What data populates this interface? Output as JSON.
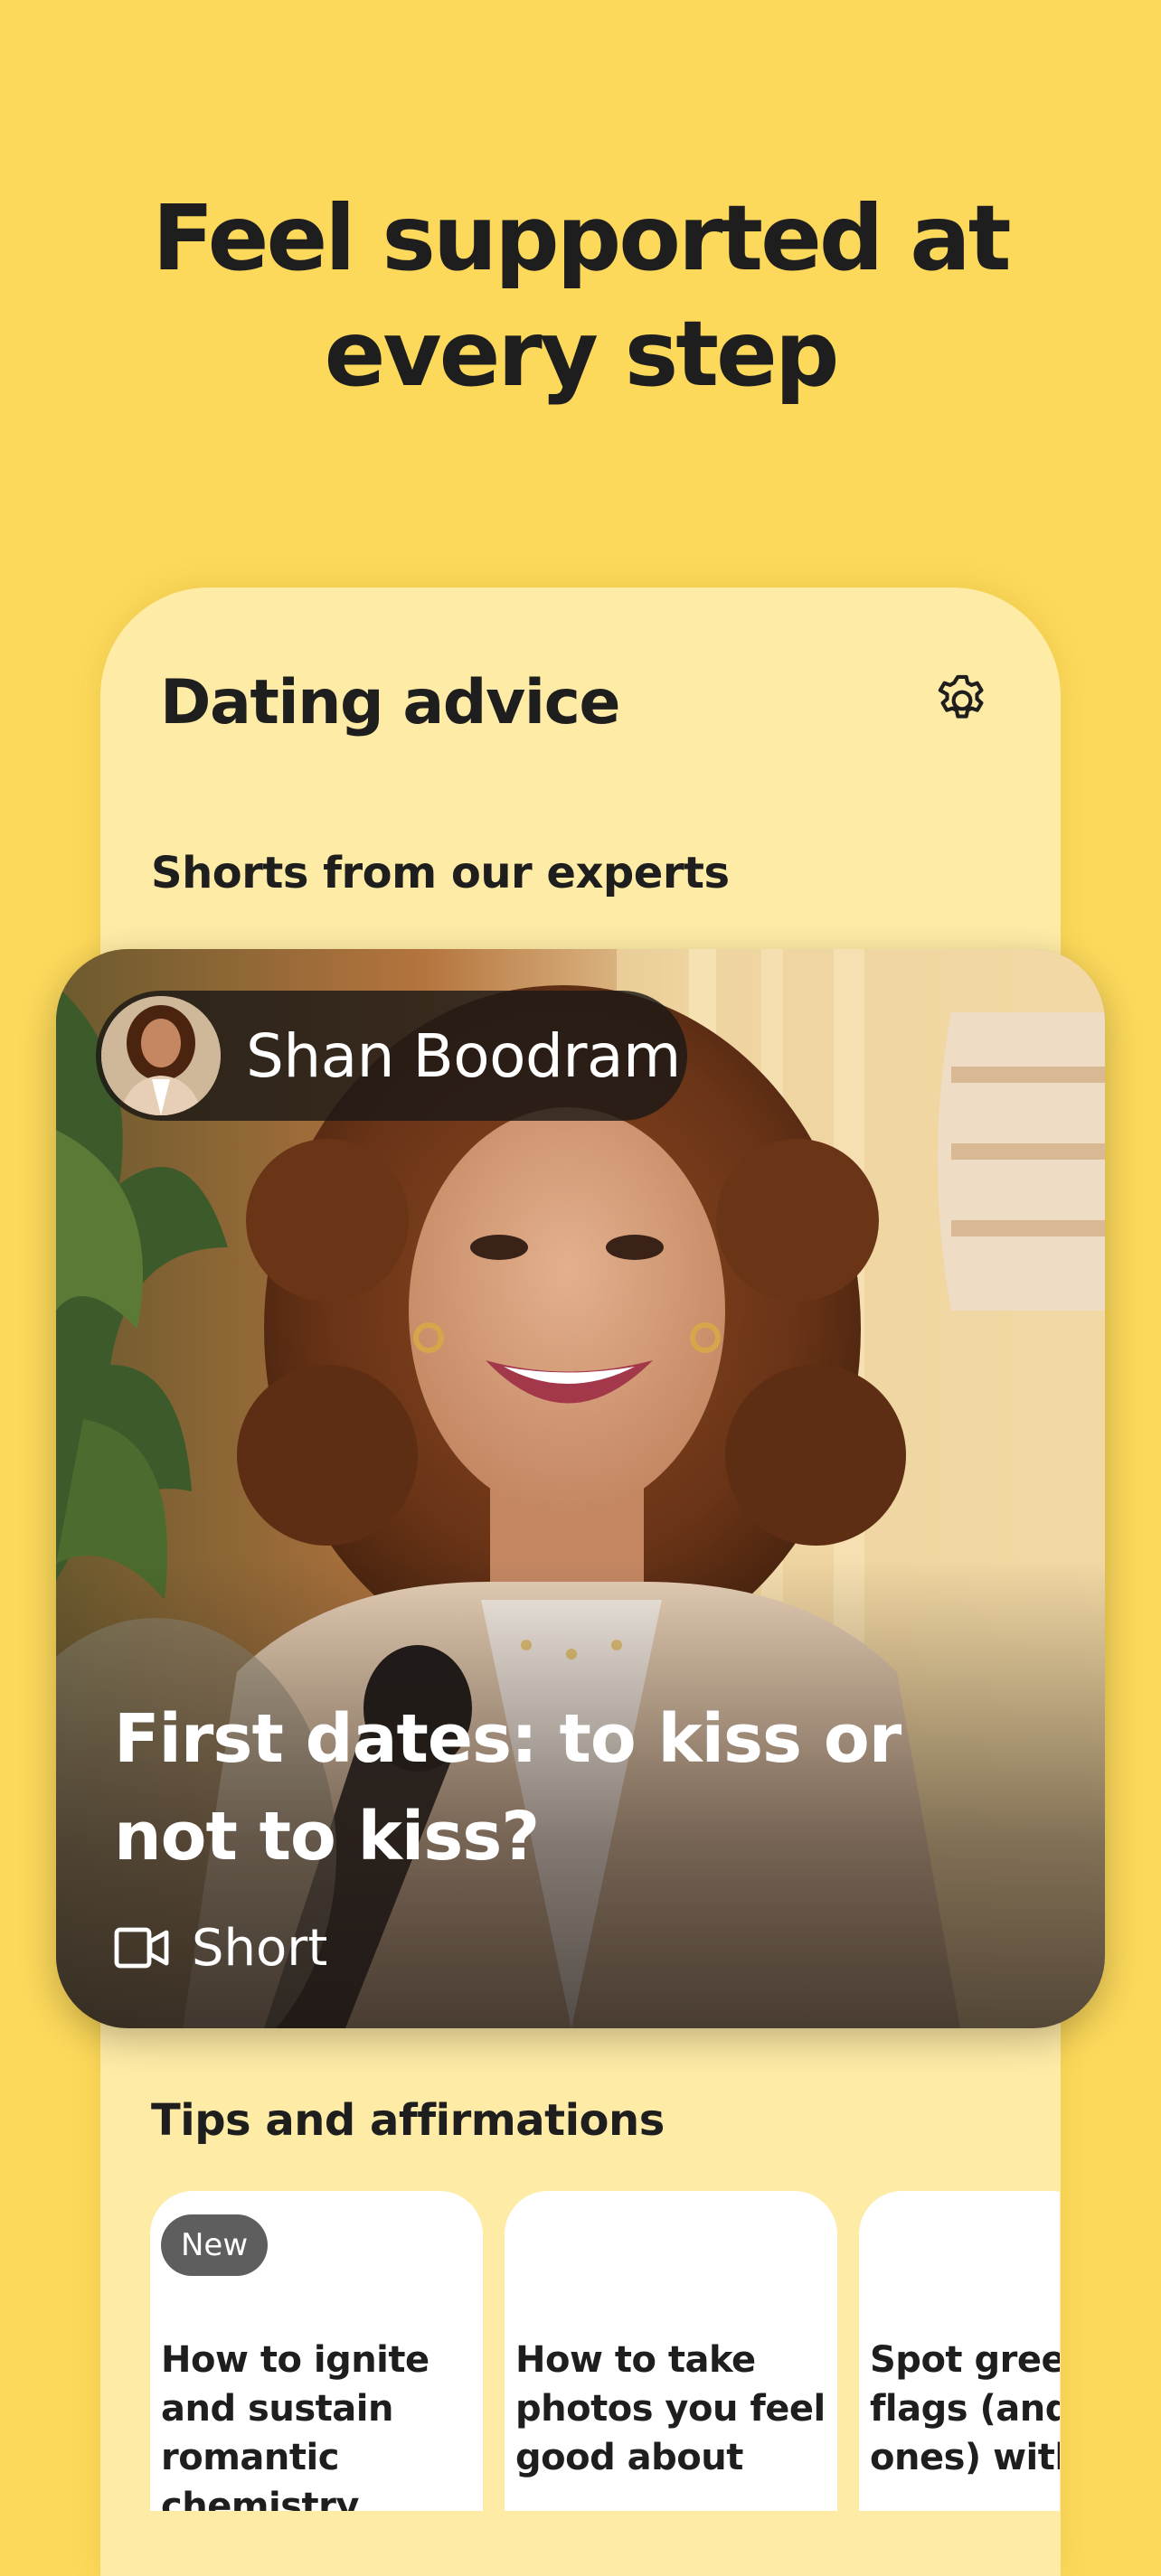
{
  "headline": {
    "line1": "Feel supported at",
    "line2": "every step"
  },
  "screen": {
    "title": "Dating advice",
    "settings_icon": "gear-icon"
  },
  "shorts": {
    "section_title": "Shorts from our experts",
    "video": {
      "expert_name": "Shan Boodram",
      "title": "First dates: to kiss or not to kiss?",
      "type_label": "Short",
      "type_icon": "video-camera-icon"
    }
  },
  "tips": {
    "section_title": "Tips and affirmations",
    "cards": [
      {
        "badge": "New",
        "text": "How to ignite and sustain romantic chemistry"
      },
      {
        "badge": "",
        "text": "How to take photos you feel good about"
      },
      {
        "badge": "",
        "text": "Spot green flags (and red ones) with Shan"
      }
    ]
  },
  "colors": {
    "background": "#FCD95B",
    "panel": "#FEEBA6",
    "text": "#1E1E1E",
    "badge": "#5E5E5E"
  }
}
